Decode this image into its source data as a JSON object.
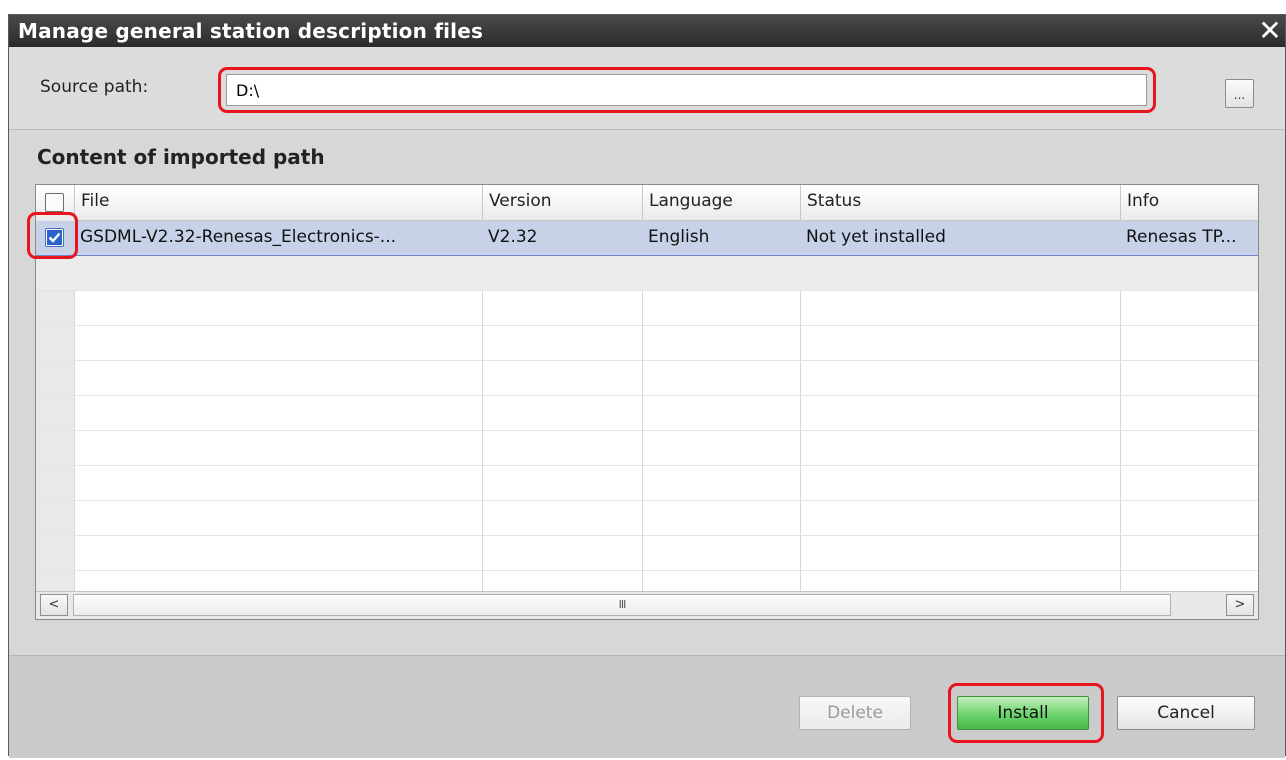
{
  "window": {
    "title": "Manage general station description files",
    "close_glyph": "✕"
  },
  "source": {
    "label": "Source path:",
    "value": "D:\\",
    "browse_label": "..."
  },
  "content": {
    "heading": "Content of imported path"
  },
  "table": {
    "columns": [
      "File",
      "Version",
      "Language",
      "Status",
      "Info"
    ],
    "rows": [
      {
        "checked": true,
        "file": "GSDML-V2.32-Renesas_Electronics-...",
        "version": "V2.32",
        "language": "English",
        "status": "Not yet installed",
        "info": "Renesas TP..."
      }
    ]
  },
  "scrollbar": {
    "left_arrow": "<",
    "right_arrow": ">",
    "thumb_grip": "III"
  },
  "buttons": {
    "delete": "Delete",
    "install": "Install",
    "cancel": "Cancel"
  },
  "colors": {
    "highlight": "#e8141e",
    "selection": "#c7d2e8",
    "install_green": "#6cd36c"
  }
}
